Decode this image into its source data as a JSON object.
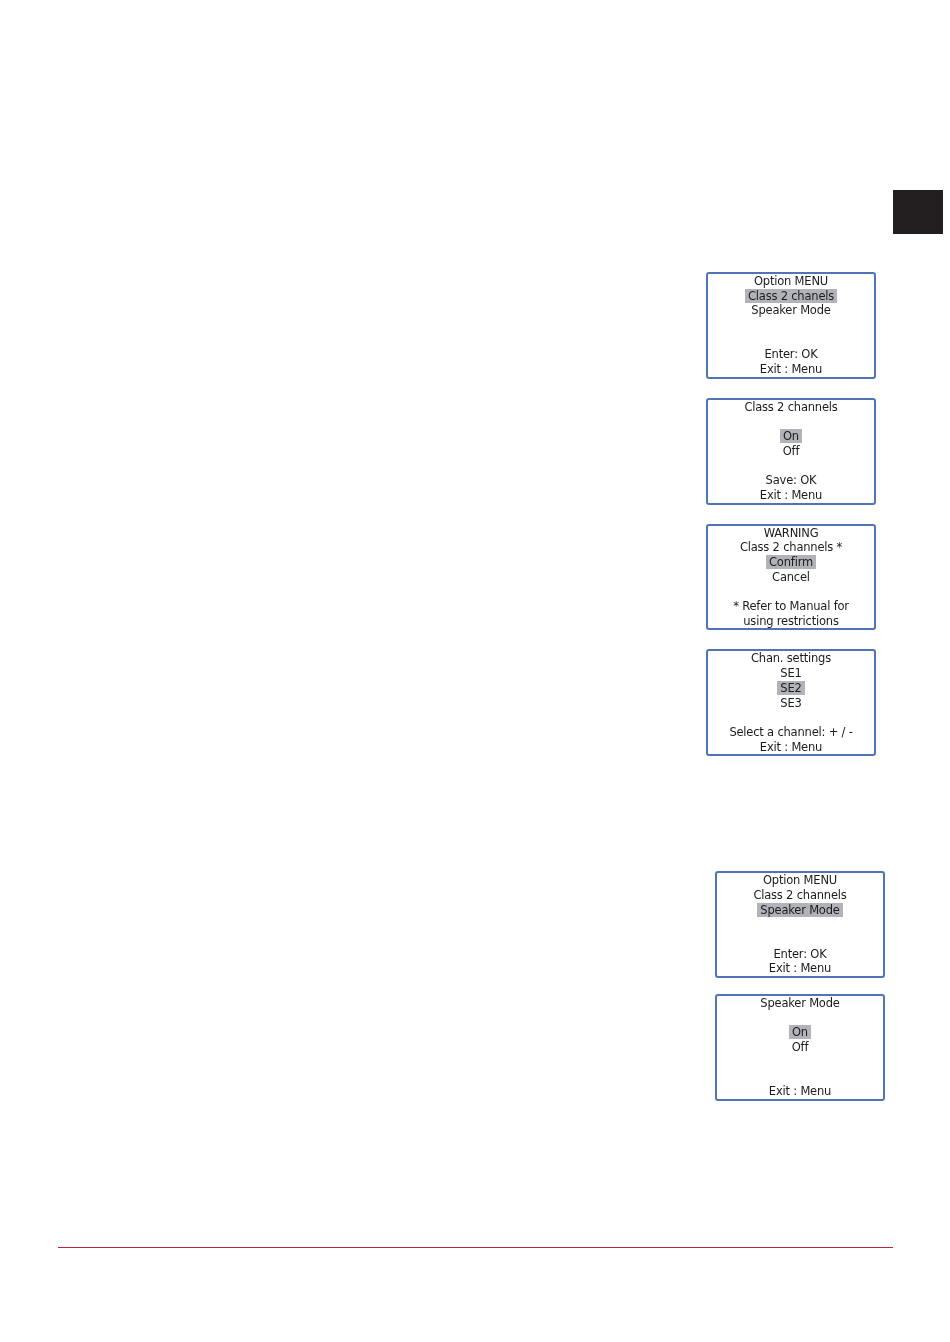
{
  "screen_groups": [
    {
      "screens": [
        {
          "lines": [
            {
              "kind": "title",
              "text": "Option MENU"
            },
            {
              "kind": "option",
              "text": "Class 2 chanels",
              "selected": true
            },
            {
              "kind": "option",
              "text": "Speaker Mode",
              "selected": false
            },
            {
              "kind": "spacer"
            },
            {
              "kind": "spacer"
            },
            {
              "kind": "note",
              "text": "Enter: OK"
            },
            {
              "kind": "note",
              "text": "Exit : Menu"
            }
          ]
        },
        {
          "lines": [
            {
              "kind": "title",
              "text": "Class 2 channels"
            },
            {
              "kind": "spacer"
            },
            {
              "kind": "option",
              "text": "On",
              "selected": true
            },
            {
              "kind": "option",
              "text": "Off",
              "selected": false
            },
            {
              "kind": "spacer"
            },
            {
              "kind": "note",
              "text": "Save: OK"
            },
            {
              "kind": "note",
              "text": "Exit : Menu"
            }
          ]
        },
        {
          "lines": [
            {
              "kind": "title",
              "text": "WARNING"
            },
            {
              "kind": "title",
              "text": "Class 2 channels *"
            },
            {
              "kind": "option",
              "text": "Confirm",
              "selected": true
            },
            {
              "kind": "option",
              "text": "Cancel",
              "selected": false
            },
            {
              "kind": "spacer"
            },
            {
              "kind": "note",
              "text": "* Refer to Manual for"
            },
            {
              "kind": "note",
              "text": "using restrictions"
            }
          ]
        },
        {
          "lines": [
            {
              "kind": "title",
              "text": "Chan. settings"
            },
            {
              "kind": "option",
              "text": "SE1",
              "selected": false
            },
            {
              "kind": "option",
              "text": "SE2",
              "selected": true
            },
            {
              "kind": "option",
              "text": "SE3",
              "selected": false
            },
            {
              "kind": "spacer"
            },
            {
              "kind": "note",
              "text": "Select a channel: + / -"
            },
            {
              "kind": "note",
              "text": "Exit : Menu"
            }
          ]
        }
      ]
    },
    {
      "screens": [
        {
          "lines": [
            {
              "kind": "title",
              "text": "Option MENU"
            },
            {
              "kind": "option",
              "text": "Class 2 channels",
              "selected": false
            },
            {
              "kind": "option",
              "text": "Speaker Mode",
              "selected": true
            },
            {
              "kind": "spacer"
            },
            {
              "kind": "spacer"
            },
            {
              "kind": "note",
              "text": "Enter: OK"
            },
            {
              "kind": "note",
              "text": "Exit : Menu"
            }
          ]
        },
        {
          "lines": [
            {
              "kind": "title",
              "text": "Speaker Mode"
            },
            {
              "kind": "spacer"
            },
            {
              "kind": "option",
              "text": "On",
              "selected": true
            },
            {
              "kind": "option",
              "text": "Off",
              "selected": false
            },
            {
              "kind": "spacer"
            },
            {
              "kind": "spacer"
            },
            {
              "kind": "note",
              "text": "Exit : Menu"
            }
          ]
        }
      ]
    }
  ]
}
